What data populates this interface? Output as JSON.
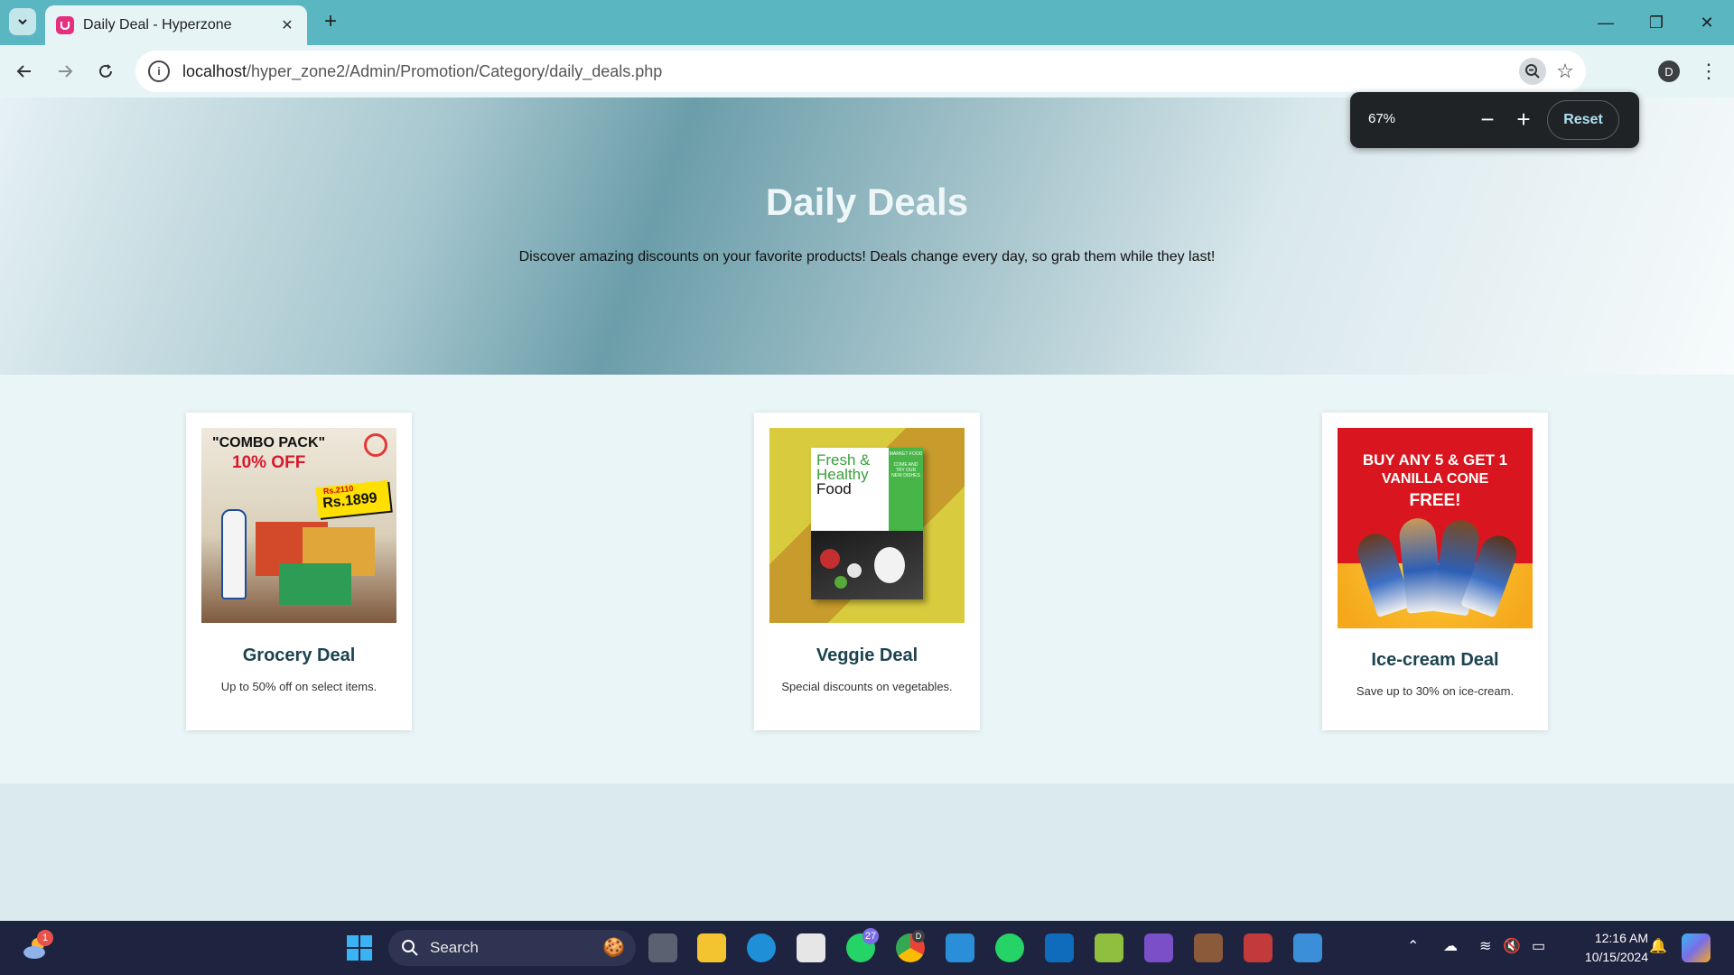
{
  "browser": {
    "tab": {
      "title": "Daily Deal - Hyperzone",
      "favicon_icon": "hyperzone-favicon-icon"
    },
    "url": {
      "host": "localhost",
      "path": "/hyper_zone2/Admin/Promotion/Category/daily_deals.php"
    },
    "profile_initial": "D",
    "zoom_popup": {
      "level": "67%",
      "reset_label": "Reset"
    }
  },
  "hero": {
    "title": "Daily Deals",
    "subtitle": "Discover amazing discounts on your favorite products! Deals change every day, so grab them while they last!"
  },
  "deals": [
    {
      "title": "Grocery Deal",
      "description": "Up to 50% off on select items.",
      "image": {
        "line1": "\"COMBO PACK\"",
        "line2": "10% OFF",
        "old_price": "Rs.2110",
        "price": "Rs.1899"
      }
    },
    {
      "title": "Veggie Deal",
      "description": "Special discounts on vegetables.",
      "image": {
        "line1": "Fresh &",
        "line2": "Healthy",
        "line3": "Food",
        "badge": "MARKET FOOD",
        "tagline": "COME AND TRY OUR NEW DISHES"
      }
    },
    {
      "title": "Ice-cream Deal",
      "description": "Save up to 30% on ice-cream.",
      "image": {
        "line1": "BUY ANY 5 & GET 1",
        "line2": "VANILLA CONE",
        "line3": "FREE!"
      }
    }
  ],
  "taskbar": {
    "search_label": "Search",
    "weather_badge": "1",
    "whatsapp_badge": "27",
    "chrome_profile": "D",
    "clock": {
      "time": "12:16 AM",
      "date": "10/15/2024"
    }
  }
}
